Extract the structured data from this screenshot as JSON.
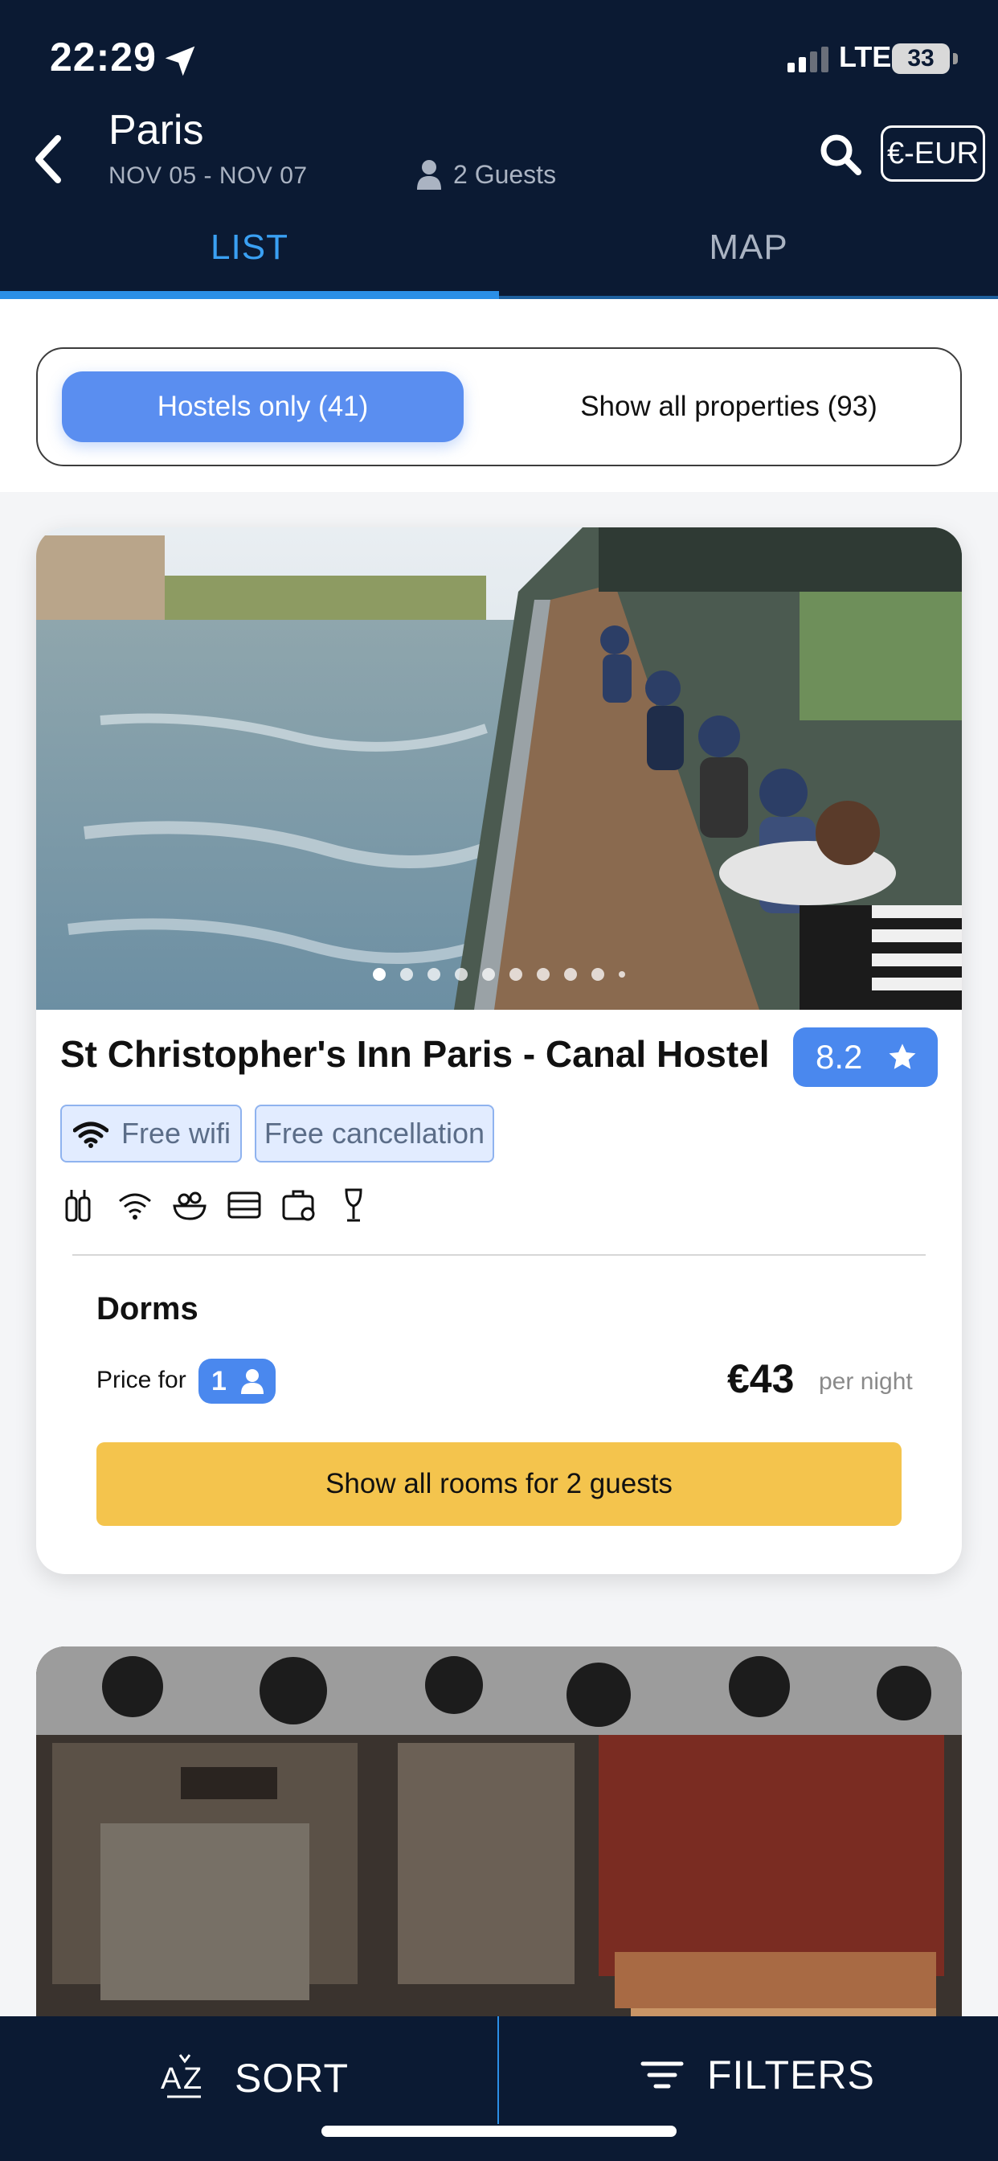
{
  "status_bar": {
    "time": "22:29",
    "network": "LTE",
    "battery": "33"
  },
  "header": {
    "city": "Paris",
    "dates": "NOV 05 - NOV 07",
    "guests": "2 Guests",
    "currency": "€-EUR"
  },
  "tabs": [
    {
      "label": "LIST",
      "active": true
    },
    {
      "label": "MAP",
      "active": false
    }
  ],
  "filter_toggle": {
    "hostels_only": "Hostels only (41)",
    "show_all": "Show all properties (93)",
    "selected": "hostels_only"
  },
  "listings": [
    {
      "name": "St Christopher's Inn Paris - Canal Hostel",
      "rating": "8.2",
      "features": [
        "Free wifi",
        "Free cancellation"
      ],
      "amenity_icons": [
        "bar-icon",
        "wifi-icon",
        "breakfast-icon",
        "lockers-icon",
        "luggage-storage-icon",
        "wine-glass-icon"
      ],
      "photo_count": 10,
      "active_photo": 1,
      "room_type": "Dorms",
      "price_for_label": "Price for",
      "price_for_guests": "1",
      "price": "€43",
      "price_unit": "per night",
      "cta": "Show all rooms for 2 guests"
    }
  ],
  "bottom_bar": {
    "sort": "SORT",
    "filters": "FILTERS"
  },
  "colors": {
    "header_bg": "#0b1a33",
    "accent_blue": "#4a88ee",
    "tab_active": "#3aa0f3",
    "cta_yellow": "#f4c44d",
    "feature_chip_bg": "#e2ecff"
  }
}
